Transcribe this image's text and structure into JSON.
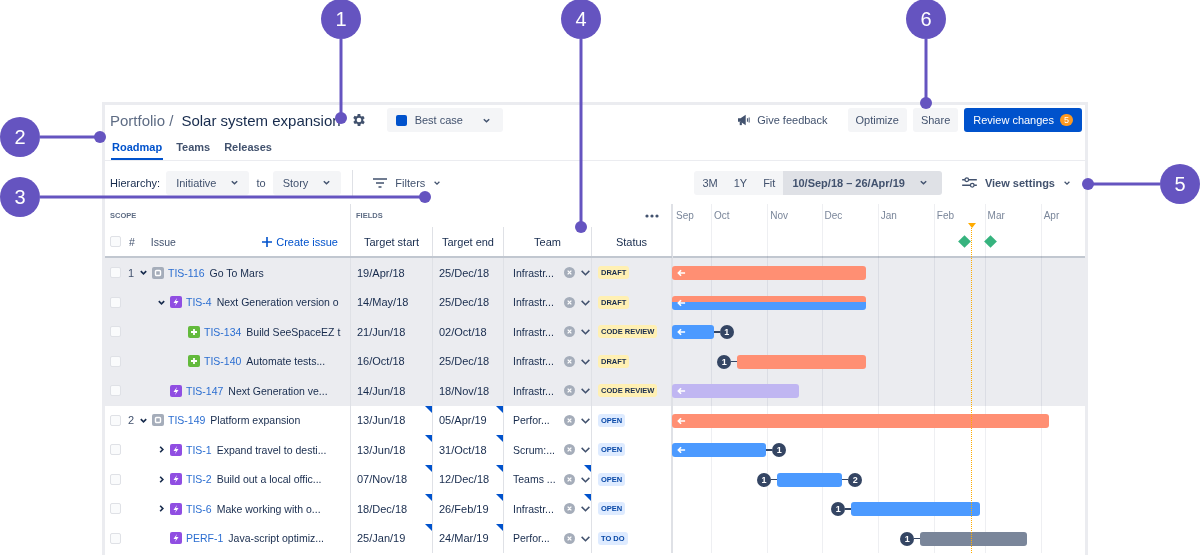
{
  "callouts": [
    {
      "number": "1"
    },
    {
      "number": "2"
    },
    {
      "number": "3"
    },
    {
      "number": "4"
    },
    {
      "number": "5"
    },
    {
      "number": "6"
    }
  ],
  "header": {
    "breadcrumb": "Portfolio /",
    "title": "Solar system expansion",
    "scenario": {
      "label": "Best case",
      "color": "#0052cc"
    },
    "feedback": "Give feedback",
    "buttons": [
      {
        "label": "Optimize",
        "kind": "default"
      },
      {
        "label": "Share",
        "kind": "default"
      },
      {
        "label": "Review changes",
        "kind": "primary",
        "badge": "5"
      }
    ]
  },
  "tabs": [
    {
      "label": "Roadmap",
      "selected": true
    },
    {
      "label": "Teams",
      "selected": false
    },
    {
      "label": "Releases",
      "selected": false
    }
  ],
  "toolbar": {
    "hierarchy_label": "Hierarchy:",
    "from": "Initiative",
    "to_label": "to",
    "to": "Story",
    "filters": "Filters",
    "zoom": [
      {
        "label": "3M",
        "kind": "preset",
        "selected": false
      },
      {
        "label": "1Y",
        "kind": "preset",
        "selected": false
      },
      {
        "label": "Fit",
        "kind": "preset",
        "selected": false
      },
      {
        "label": "10/Sep/18 – 26/Apr/19",
        "kind": "range",
        "selected": true
      }
    ],
    "view_settings": "View settings"
  },
  "table": {
    "scope_label": "SCOPE",
    "fields_label": "FIELDS",
    "select_all_checked": false,
    "rank_header": "#",
    "issue_header": "Issue",
    "create_issue": "Create issue",
    "columns": [
      "Target start",
      "Target end",
      "Team",
      "Status"
    ],
    "months": [
      "Sep",
      "Oct",
      "Nov",
      "Dec",
      "Jan",
      "Feb",
      "Mar",
      "Apr"
    ],
    "rows": [
      {
        "rank": "1",
        "checked": false,
        "selected": true,
        "expanded": true,
        "kind": "initiative",
        "key": "TIS-116",
        "summary": "Go To Mars",
        "start": {
          "text": "19/Apr/18",
          "changed": false
        },
        "end": {
          "text": "25/Dec/18",
          "changed": false
        },
        "team": {
          "text": "Infrastr...",
          "changed": false
        },
        "status": {
          "label": "DRAFT",
          "color": "#fff0b3"
        },
        "bars": [
          {
            "color": "#ff8f73"
          }
        ],
        "children": [
          {
            "checked": false,
            "selected": true,
            "expanded": true,
            "kind": "epic",
            "key": "TIS-4",
            "summary": "Next Generation version o",
            "start": {
              "text": "14/May/18",
              "changed": false
            },
            "end": {
              "text": "25/Dec/18",
              "changed": false
            },
            "team": {
              "text": "Infrastr...",
              "changed": false
            },
            "status": {
              "label": "DRAFT",
              "color": "#fff0b3"
            },
            "bars": [
              {
                "color": "#ff8f73"
              },
              {
                "color": "#4c9aff"
              }
            ],
            "children": [
              {
                "checked": false,
                "selected": true,
                "kind": "story",
                "key": "TIS-134",
                "summary": "Build SeeSpaceEZ t",
                "start": {
                  "text": "21/Jun/18",
                  "changed": false
                },
                "end": {
                  "text": "02/Oct/18",
                  "changed": false
                },
                "team": {
                  "text": "Infrastr...",
                  "changed": false
                },
                "status": {
                  "label": "CODE REVIEW",
                  "color": "#fff0b3"
                },
                "bars": [
                  {
                    "color": "#4c9aff"
                  }
                ],
                "deps_after": "1"
              },
              {
                "checked": false,
                "selected": true,
                "kind": "story",
                "key": "TIS-140",
                "summary": "Automate tests...",
                "start": {
                  "text": "16/Oct/18",
                  "changed": false
                },
                "end": {
                  "text": "25/Dec/18",
                  "changed": false
                },
                "team": {
                  "text": "Infrastr...",
                  "changed": false
                },
                "status": {
                  "label": "DRAFT",
                  "color": "#fff0b3"
                },
                "bars": [
                  {
                    "color": "#ff8f73"
                  }
                ],
                "deps_before": "1"
              }
            ]
          },
          {
            "checked": false,
            "selected": true,
            "kind": "epic",
            "key": "TIS-147",
            "summary": "Next Generation ve...",
            "start": {
              "text": "14/Jun/18",
              "changed": false
            },
            "end": {
              "text": "18/Nov/18",
              "changed": false
            },
            "team": {
              "text": "Infrastr...",
              "changed": false
            },
            "status": {
              "label": "CODE REVIEW",
              "color": "#fff0b3"
            },
            "bars": [
              {
                "color": "#c0b6f2"
              }
            ]
          }
        ]
      },
      {
        "rank": "2",
        "checked": false,
        "selected": false,
        "expanded": true,
        "kind": "initiative",
        "key": "TIS-149",
        "summary": "Platform expansion",
        "start": {
          "text": "13/Jun/18",
          "changed": true
        },
        "end": {
          "text": "05/Apr/19",
          "changed": true
        },
        "team": {
          "text": "Perfor...",
          "changed": false
        },
        "status": {
          "label": "OPEN",
          "color": "#deebff"
        },
        "bars": [
          {
            "color": "#ff8f73"
          }
        ],
        "children": [
          {
            "checked": false,
            "selected": false,
            "expanded": false,
            "kind": "epic",
            "key": "TIS-1",
            "summary": "Expand travel to desti...",
            "start": {
              "text": "13/Jun/18",
              "changed": true
            },
            "end": {
              "text": "31/Oct/18",
              "changed": true
            },
            "team": {
              "text": "Scrum:...",
              "changed": false
            },
            "status": {
              "label": "OPEN",
              "color": "#deebff"
            },
            "bars": [
              {
                "color": "#4c9aff"
              }
            ],
            "deps_after": "1"
          },
          {
            "checked": false,
            "selected": false,
            "expanded": false,
            "kind": "epic",
            "key": "TIS-2",
            "summary": "Build out a local offic...",
            "start": {
              "text": "07/Nov/18",
              "changed": true
            },
            "end": {
              "text": "12/Dec/18",
              "changed": true
            },
            "team": {
              "text": "Teams ...",
              "changed": true
            },
            "status": {
              "label": "OPEN",
              "color": "#deebff"
            },
            "bars": [
              {
                "color": "#4c9aff"
              }
            ],
            "deps_before": "1",
            "deps_after": "2"
          },
          {
            "checked": false,
            "selected": false,
            "expanded": false,
            "kind": "epic",
            "key": "TIS-6",
            "summary": "Make working with o...",
            "start": {
              "text": "18/Dec/18",
              "changed": true
            },
            "end": {
              "text": "26/Feb/19",
              "changed": true
            },
            "team": {
              "text": "Infrastr...",
              "changed": true
            },
            "status": {
              "label": "OPEN",
              "color": "#deebff"
            },
            "bars": [
              {
                "color": "#4c9aff"
              }
            ],
            "deps_before": "1"
          },
          {
            "checked": false,
            "selected": false,
            "kind": "epic",
            "key": "PERF-1",
            "summary": "Java-script optimiz...",
            "start": {
              "text": "25/Jan/19",
              "changed": true
            },
            "end": {
              "text": "24/Mar/19",
              "changed": true
            },
            "team": {
              "text": "Perfor...",
              "changed": false
            },
            "status": {
              "label": "TO DO",
              "color": "#deebff"
            },
            "bars": [
              {
                "color": "#7a869a"
              }
            ],
            "deps_before": "1"
          }
        ]
      }
    ]
  }
}
